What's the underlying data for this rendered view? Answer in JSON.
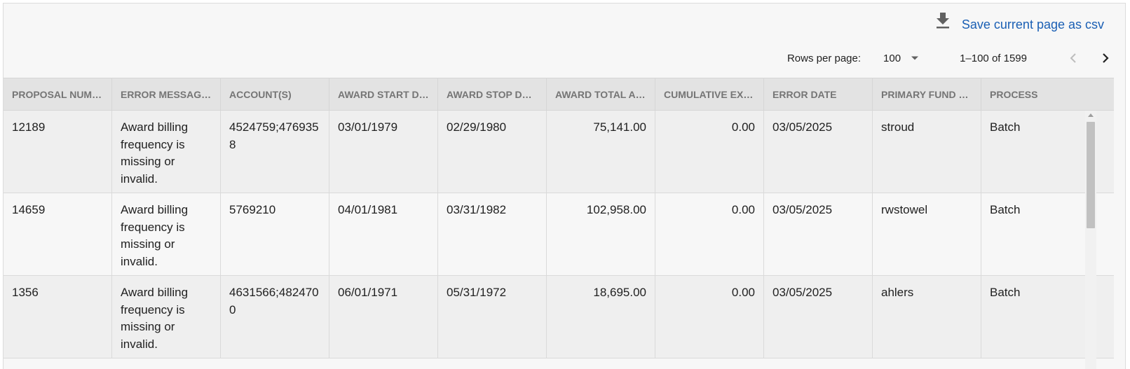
{
  "toolbar": {
    "download_icon": "download-icon",
    "save_label": "Save current page as csv"
  },
  "pager": {
    "rows_per_page_label": "Rows per page:",
    "rows_per_page_value": "100",
    "range_label": "1–100 of 1599",
    "prev_icon": "chevron-left-icon",
    "next_icon": "chevron-right-icon"
  },
  "table": {
    "columns": [
      "PROPOSAL NUMB…",
      "ERROR MESSAGES",
      "ACCOUNT(S)",
      "AWARD START DA…",
      "AWARD STOP DATE",
      "AWARD TOTAL A…",
      "CUMULATIVE EXP…",
      "ERROR DATE",
      "PRIMARY FUND …",
      "PROCESS"
    ],
    "rows": [
      {
        "proposal": "12189",
        "error": "Award billing frequency is missing or invalid.",
        "accounts": "4524759;4769358",
        "start": "03/01/1979",
        "stop": "02/29/1980",
        "total": "75,141.00",
        "cumulative": "0.00",
        "error_date": "03/05/2025",
        "fund": "stroud",
        "process": "Batch"
      },
      {
        "proposal": "14659",
        "error": "Award billing frequency is missing or invalid.",
        "accounts": "5769210",
        "start": "04/01/1981",
        "stop": "03/31/1982",
        "total": "102,958.00",
        "cumulative": "0.00",
        "error_date": "03/05/2025",
        "fund": "rwstowel",
        "process": "Batch"
      },
      {
        "proposal": "1356",
        "error": "Award billing frequency is missing or invalid.",
        "accounts": "4631566;4824700",
        "start": "06/01/1971",
        "stop": "05/31/1972",
        "total": "18,695.00",
        "cumulative": "0.00",
        "error_date": "03/05/2025",
        "fund": "ahlers",
        "process": "Batch"
      }
    ]
  },
  "colors": {
    "link": "#1a5fb4",
    "header_bg": "#e3e3e3",
    "row_odd": "#efefef",
    "row_even": "#f7f7f7"
  }
}
